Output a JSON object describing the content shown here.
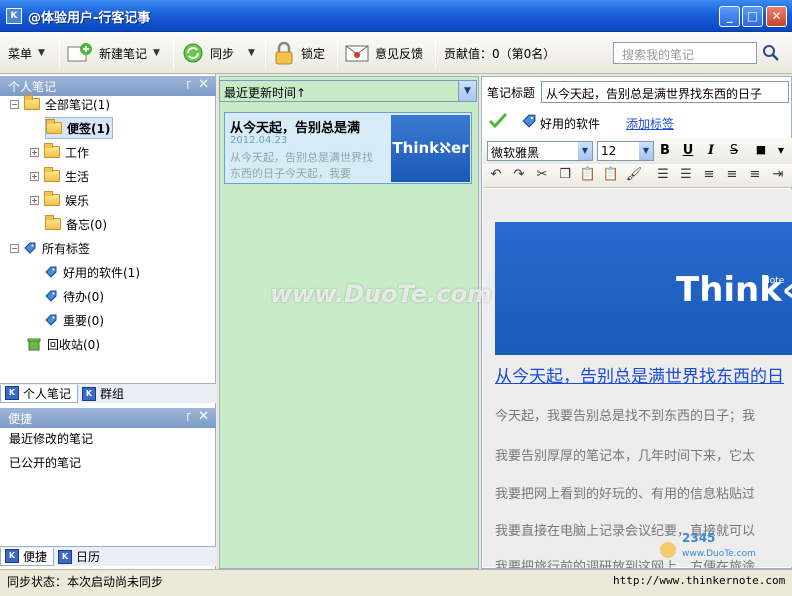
{
  "window": {
    "title": "@体验用户-行客记事",
    "app_icon": "K"
  },
  "toolbar": {
    "menu": "菜单",
    "new_note": "新建笔记",
    "sync": "同步",
    "lock": "锁定",
    "feedback": "意见反馈",
    "contribution": "贡献值：0（第0名）",
    "search_placeholder": "搜索我的笔记"
  },
  "left": {
    "pane_title": "个人笔记",
    "tree": {
      "all_notes": "全部笔记(1)",
      "memo": "便签(1)",
      "work": "工作",
      "life": "生活",
      "fun": "娱乐",
      "backup": "备忘(0)",
      "all_tags": "所有标签",
      "tag_software": "好用的软件(1)",
      "tag_todo": "待办(0)",
      "tag_important": "重要(0)",
      "recycle": "回收站(0)"
    },
    "tabs": {
      "personal": "个人笔记",
      "group": "群组"
    },
    "quick_title": "便捷",
    "quick_items": [
      "最近修改的笔记",
      "已公开的笔记"
    ],
    "tabs2": {
      "quick": "便捷",
      "calendar": "日历"
    }
  },
  "middle": {
    "sort": "最近更新时间↑",
    "note": {
      "title": "从今天起，告别总是满",
      "date": "2012.04.23",
      "snippet": "从今天起，告别总是满世界找东西的日子今天起，我要",
      "thumb_logo": "Thinkℵer"
    }
  },
  "right": {
    "title_label": "笔记标题",
    "title_value": "从今天起，告别总是满世界找东西的日子",
    "tag": "好用的软件",
    "add_tag": "添加标签",
    "font": "微软雅黑",
    "size": "12",
    "format_buttons": [
      "B",
      "U",
      "I",
      "S"
    ],
    "banner_logo": "Think«",
    "banner_note": "Note",
    "heading": "从今天起，告别总是满世界找东西的日",
    "paragraphs": [
      "今天起，我要告别总是找不到东西的日子；我",
      "我要告别厚厚的笔记本，几年时间下来，它太",
      "我要把网上看到的好玩的、有用的信息粘贴过",
      "我要直接在电脑上记录会议纪要，直接就可以",
      "我要把旅行前的调研放到这网上，方便在旅途"
    ]
  },
  "watermark": "www.DuoTe.com",
  "status": {
    "text": "同步状态：本次启动尚未同步",
    "url": "http://www.thinkernote.com"
  },
  "colors": {
    "titlebar": "#1a5fd8",
    "left_bg": "#ffffff",
    "middle_bg": "#c8ecc8",
    "link": "#1a4ad8"
  }
}
